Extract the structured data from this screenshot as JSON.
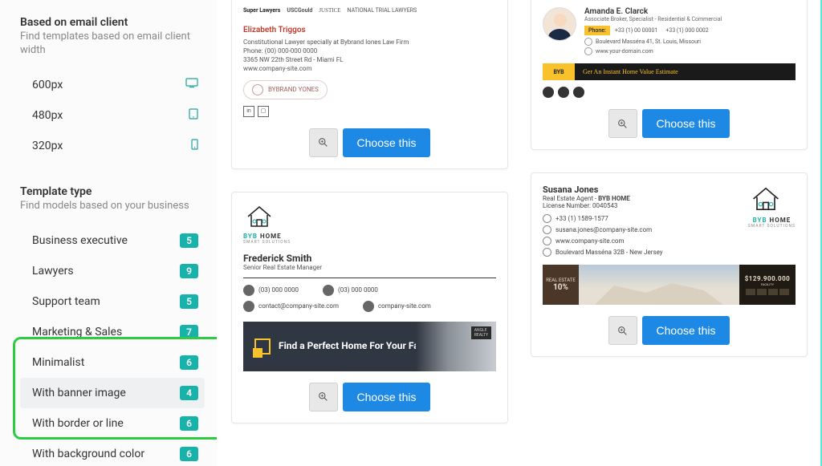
{
  "sidebar": {
    "emailClient": {
      "title": "Based on email client",
      "subtitle": "Find templates based on email client width",
      "widths": [
        "600px",
        "480px",
        "320px"
      ]
    },
    "templateType": {
      "title": "Template type",
      "subtitle": "Find models based on your business",
      "items": [
        {
          "label": "Business executive",
          "count": "5"
        },
        {
          "label": "Lawyers",
          "count": "9"
        },
        {
          "label": "Support team",
          "count": "5"
        },
        {
          "label": "Marketing & Sales",
          "count": "7"
        },
        {
          "label": "Minimalist",
          "count": "6"
        },
        {
          "label": "With banner image",
          "count": "4"
        },
        {
          "label": "With border or line",
          "count": "6"
        },
        {
          "label": "With background color",
          "count": "6"
        }
      ]
    }
  },
  "buttons": {
    "choose": "Choose this"
  },
  "sig1": {
    "logos": [
      "Super Lawyers",
      "USCGould",
      "JUSTICE",
      "NATIONAL TRIAL LAWYERS"
    ],
    "name": "Elizabeth Triggos",
    "role": "Constitutional Lawyer specially at Bybrand Iones Law Firm",
    "phone": "Phone: (00) 000-000 0000",
    "addr": "3365 NW 22th Street Rd - Miami FL",
    "site": "www.company-site.com",
    "badge": "BYBRAND YONES"
  },
  "sig2": {
    "name": "Amanda E. Clarck",
    "assoc": "Associate Broker, Specialist - Residential & Commercial",
    "phoneLabel": "Phone:",
    "phone1": "+33 (1) 00 00001",
    "phone2": "+33 (1) 000 0002",
    "addr": "Boulevard Masséna 41, St. Louis, Missouri",
    "site": "www.your-domain.com",
    "bannerLeft": "BYB",
    "bannerText": "Ger An Instant Home Value Estimate"
  },
  "sig3": {
    "brand": "BYB",
    "brandSuffix": "HOME",
    "brandSub": "SMART SOLUTIONS",
    "name": "Frederick Smith",
    "title": "Senior Real Estate Manager",
    "phone": "(03) 000 0000",
    "phone2": "(03) 000 0000",
    "email": "contact@company-site.com",
    "site": "company-site.com",
    "bannerText": "Find a Perfect Home For Your Family"
  },
  "sig4": {
    "name": "Susana Jones",
    "rolePrefix": "Real Estate Agent - ",
    "roleBrand": "BYB HOME",
    "license": "License Number: 0040543",
    "phone": "+33 (1) 1589-1577",
    "email": "susana.jones@company-site.com",
    "site": "www.company-site.com",
    "addr": "Boulevard Masséna 32B - New Jersey",
    "brand": "BYB",
    "brandSuffix": "HOME",
    "brandSub": "SMART SOLUTIONS",
    "discountLabel": "REAL ESTATE",
    "discount": "10%",
    "price": "$129.900.000"
  }
}
